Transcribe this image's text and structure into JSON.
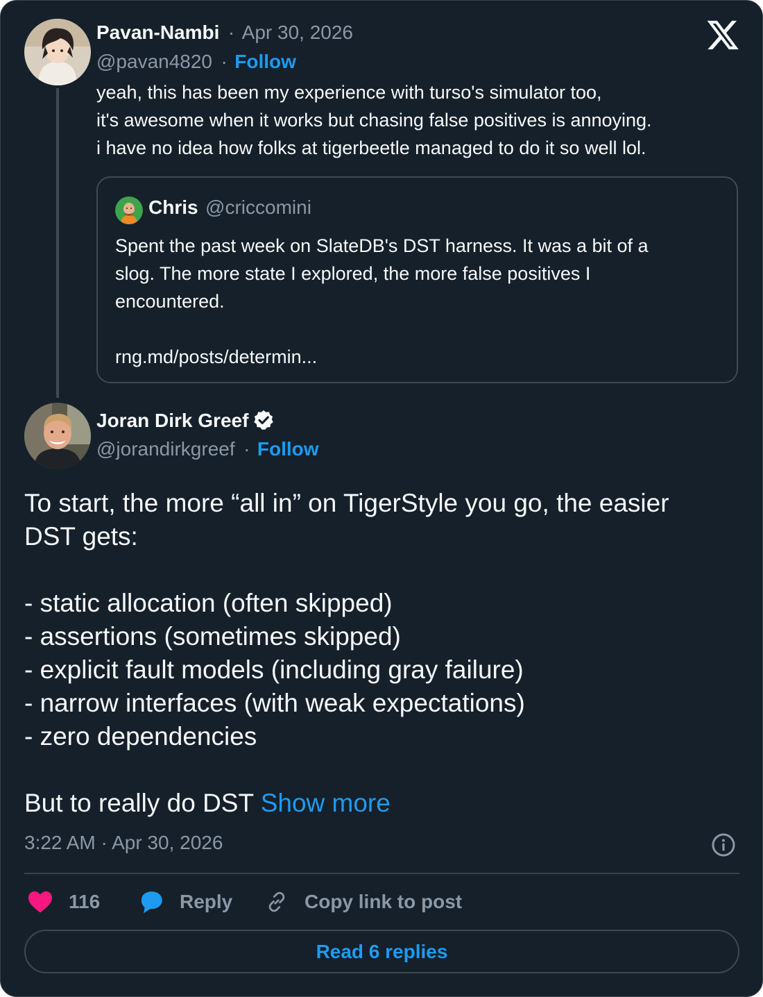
{
  "parent_post": {
    "author_name": "Pavan-Nambi",
    "separator": "·",
    "date": "Apr 30, 2026",
    "handle": "@pavan4820",
    "follow_label": "Follow",
    "avatar_icon": "anime-character-avatar",
    "body_lines": [
      "yeah, this has been my experience with turso's simulator too,",
      "it's awesome when it works but chasing false positives is annoying.",
      "i have no idea how folks at tigerbeetle managed to do it so well lol."
    ]
  },
  "quoted_post": {
    "author_name": "Chris",
    "handle": "@criccomini",
    "avatar_icon": "cartoon-avatar",
    "body_lines": [
      "Spent the past week on SlateDB's DST harness. It was a bit of a",
      "slog. The more state I explored, the more false positives I",
      "encountered."
    ],
    "link": "rng.md/posts/determin..."
  },
  "main_post": {
    "author_name": "Joran Dirk Greef",
    "verified_icon": "verified-badge-icon",
    "handle": "@jorandirkgreef",
    "follow_label": "Follow",
    "avatar_icon": "photo-avatar",
    "body_lines": [
      "To start, the more “all in” on TigerStyle you go, the easier",
      "DST gets:",
      "",
      "- static allocation (often skipped)",
      "- assertions (sometimes skipped)",
      "- explicit fault models (including gray failure)",
      "- narrow interfaces (with weak expectations)",
      "- zero dependencies",
      ""
    ],
    "last_line": "But to really do DST ",
    "show_more": "Show more",
    "timestamp": "3:22 AM · Apr 30, 2026"
  },
  "actions": {
    "like_count": "116",
    "reply_label": "Reply",
    "copy_link_label": "Copy link to post"
  },
  "read_replies_label": "Read 6 replies",
  "colors": {
    "background": "#15202b",
    "text": "#f7f9f9",
    "muted": "#8b98a5",
    "accent": "#1d9bf0",
    "like": "#f91880",
    "border": "#38444d"
  }
}
